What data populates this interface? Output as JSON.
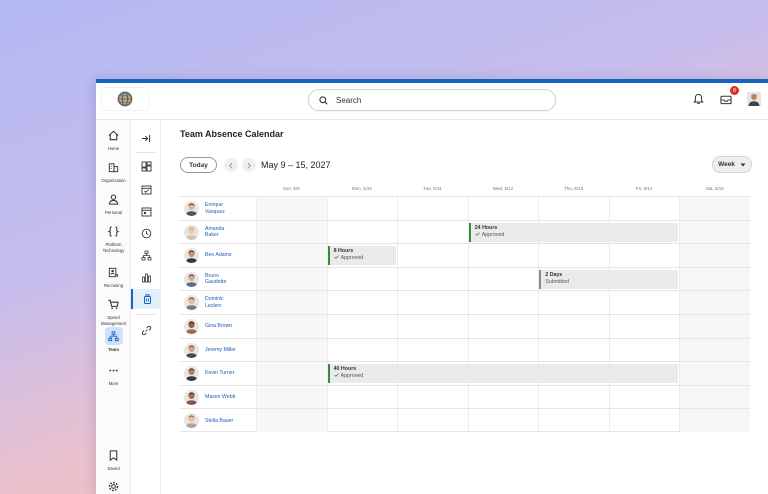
{
  "topbar": {
    "search_label": "Search",
    "notification_count": "8"
  },
  "rail": {
    "items": [
      {
        "label": "Home",
        "icon": "home-icon"
      },
      {
        "label": "Organization",
        "icon": "building-icon"
      },
      {
        "label": "Personal",
        "icon": "person-icon"
      },
      {
        "label": "Platform Technology",
        "icon": "braces-icon"
      },
      {
        "label": "Recruiting",
        "icon": "recruit-icon"
      },
      {
        "label": "Spend Management",
        "icon": "cart-icon"
      },
      {
        "label": "Team",
        "icon": "team-icon"
      },
      {
        "label": "More",
        "icon": "more-icon"
      }
    ],
    "bottom_items": [
      {
        "label": "Saved",
        "icon": "bookmark-icon"
      },
      {
        "label": "",
        "icon": "gear-icon"
      }
    ],
    "active_item": "Team"
  },
  "main": {
    "title": "Team Absence Calendar",
    "today_label": "Today",
    "date_range": "May 9 – 15, 2027",
    "view_label": "Week"
  },
  "calendar": {
    "days": [
      "Sun, 5/9",
      "Mon, 5/10",
      "Tue, 5/11",
      "Wed, 5/12",
      "Thu, 5/13",
      "Fri, 5/14",
      "Sat, 5/15"
    ],
    "people": [
      {
        "name": "Enrique Vasquez",
        "line1": "Enrique",
        "line2": "Vasquez"
      },
      {
        "name": "Amanda Baker",
        "line1": "Amanda",
        "line2": "Baker"
      },
      {
        "name": "Ben Adams",
        "line1": "Ben Adams",
        "line2": ""
      },
      {
        "name": "Bruno Gaudette",
        "line1": "Bruno",
        "line2": "Gaudette"
      },
      {
        "name": "Dominic Leclerc",
        "line1": "Dominic",
        "line2": "Leclerc"
      },
      {
        "name": "Gina Brown",
        "line1": "Gina Brown",
        "line2": ""
      },
      {
        "name": "Jeremy Miller",
        "line1": "Jeremy Miller",
        "line2": ""
      },
      {
        "name": "Kevin Turner",
        "line1": "Kevin Turner",
        "line2": ""
      },
      {
        "name": "Mason Webb",
        "line1": "Mason Webb",
        "line2": ""
      },
      {
        "name": "Stella Bauer",
        "line1": "Stella Bauer",
        "line2": ""
      }
    ],
    "events": [
      {
        "person": "Amanda Baker",
        "title": "24 Hours",
        "status": "Approved",
        "start_day": "Wed, 5/12",
        "end_day": "Fri, 5/14"
      },
      {
        "person": "Ben Adams",
        "title": "8 Hours",
        "status": "Approved",
        "start_day": "Mon, 5/10",
        "end_day": "Mon, 5/10"
      },
      {
        "person": "Bruno Gaudette",
        "title": "2 Days",
        "status": "Submitted",
        "start_day": "Thu, 5/13",
        "end_day": "Fri, 5/14"
      },
      {
        "person": "Kevin Turner",
        "title": "40 Hours",
        "status": "Approved",
        "start_day": "Mon, 5/10",
        "end_day": "Fri, 5/14"
      }
    ]
  },
  "colors": {
    "accent": "#1565c0",
    "approved": "#3a8a3c",
    "submitted": "#8a8a8a",
    "link": "#1f5bb5"
  }
}
